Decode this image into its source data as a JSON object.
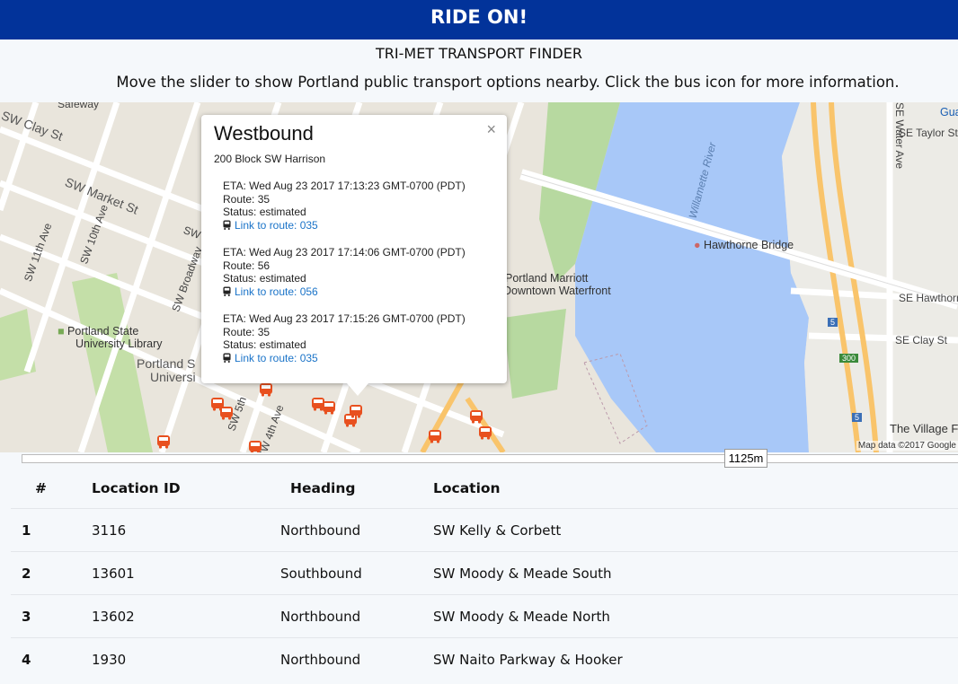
{
  "header": {
    "title": "RIDE ON!"
  },
  "subtitle": "TRI-MET TRANSPORT FINDER",
  "instructions": "Move the slider to show Portland public transport options nearby. Click the bus icon for more information.",
  "map": {
    "streets": [
      "Safeway",
      "SW Clay St",
      "SW Market St",
      "SW 11th Ave",
      "SW 10th Ave",
      "SW Broadway",
      "SW 5th",
      "SW 4th Ave",
      "SW",
      "SE Water Ave",
      "SE Taylor St",
      "SE Hawthorn",
      "SE Clay St",
      "Willamette River"
    ],
    "places": [
      "Hawthorne Bridge",
      "Portland Marriott",
      "Downtown Waterfront",
      "Portland State",
      "University Library",
      "Portland S",
      "Universi",
      "The Village F",
      "Gua"
    ],
    "shields": [
      "5",
      "300",
      "5"
    ],
    "attribution": "Map data ©2017 Google",
    "popup": {
      "heading": "Westbound",
      "address": "200 Block SW Harrison",
      "close_label": "×",
      "arrivals": [
        {
          "eta": "ETA: Wed Aug 23 2017 17:13:23 GMT-0700 (PDT)",
          "route": "Route: 35",
          "status": "Status: estimated",
          "link": "Link to route: 035"
        },
        {
          "eta": "ETA: Wed Aug 23 2017 17:14:06 GMT-0700 (PDT)",
          "route": "Route: 56",
          "status": "Status: estimated",
          "link": "Link to route: 056"
        },
        {
          "eta": "ETA: Wed Aug 23 2017 17:15:26 GMT-0700 (PDT)",
          "route": "Route: 35",
          "status": "Status: estimated",
          "link": "Link to route: 035"
        }
      ]
    }
  },
  "slider": {
    "value_label": "1125m"
  },
  "table": {
    "headers": [
      "#",
      "Location ID",
      "Heading",
      "Location"
    ],
    "rows": [
      {
        "num": "1",
        "id": "3116",
        "heading": "Northbound",
        "location": "SW Kelly & Corbett"
      },
      {
        "num": "2",
        "id": "13601",
        "heading": "Southbound",
        "location": "SW Moody & Meade South"
      },
      {
        "num": "3",
        "id": "13602",
        "heading": "Northbound",
        "location": "SW Moody & Meade North"
      },
      {
        "num": "4",
        "id": "1930",
        "heading": "Northbound",
        "location": "SW Naito Parkway & Hooker"
      }
    ]
  },
  "colors": {
    "header_bg": "#02339a",
    "link": "#1a73c8",
    "bus_marker": "#e8501f",
    "river": "#a8c8f8",
    "park": "#b7d9a0"
  }
}
